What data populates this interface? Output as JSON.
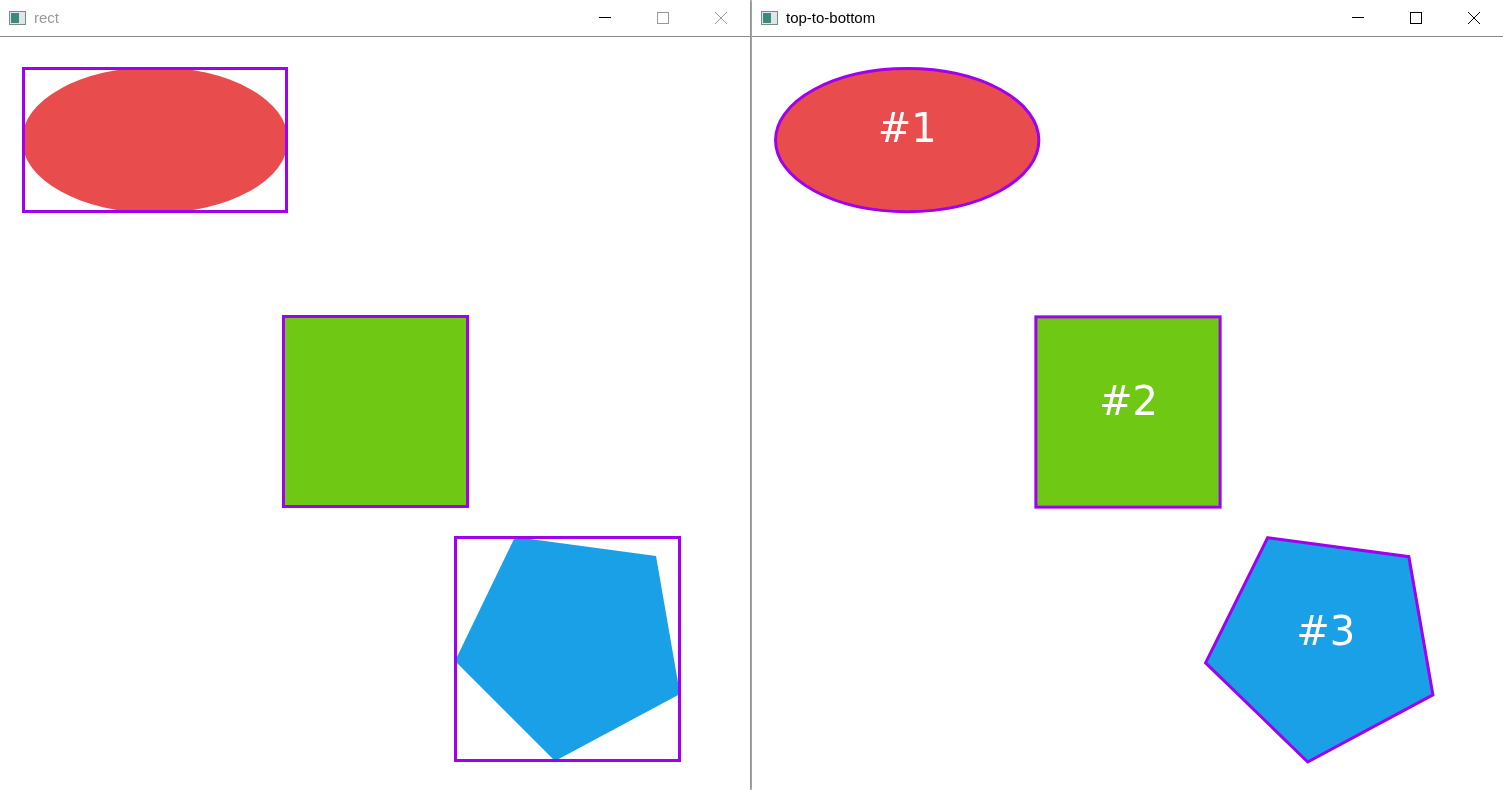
{
  "windows": [
    {
      "title": "rect",
      "active": false,
      "kind": "box",
      "shapes": [
        {
          "kind": "ellipse",
          "color": "#e84c4c"
        },
        {
          "kind": "square",
          "color": "#6fc814"
        },
        {
          "kind": "pentagon",
          "color": "#19a0e6"
        }
      ]
    },
    {
      "title": "top-to-bottom",
      "active": true,
      "kind": "contour",
      "shapes": [
        {
          "kind": "ellipse",
          "color": "#e84c4c",
          "label": "#1"
        },
        {
          "kind": "square",
          "color": "#6fc814",
          "label": "#2"
        },
        {
          "kind": "pentagon",
          "color": "#19a0e6",
          "label": "#3"
        }
      ]
    }
  ]
}
